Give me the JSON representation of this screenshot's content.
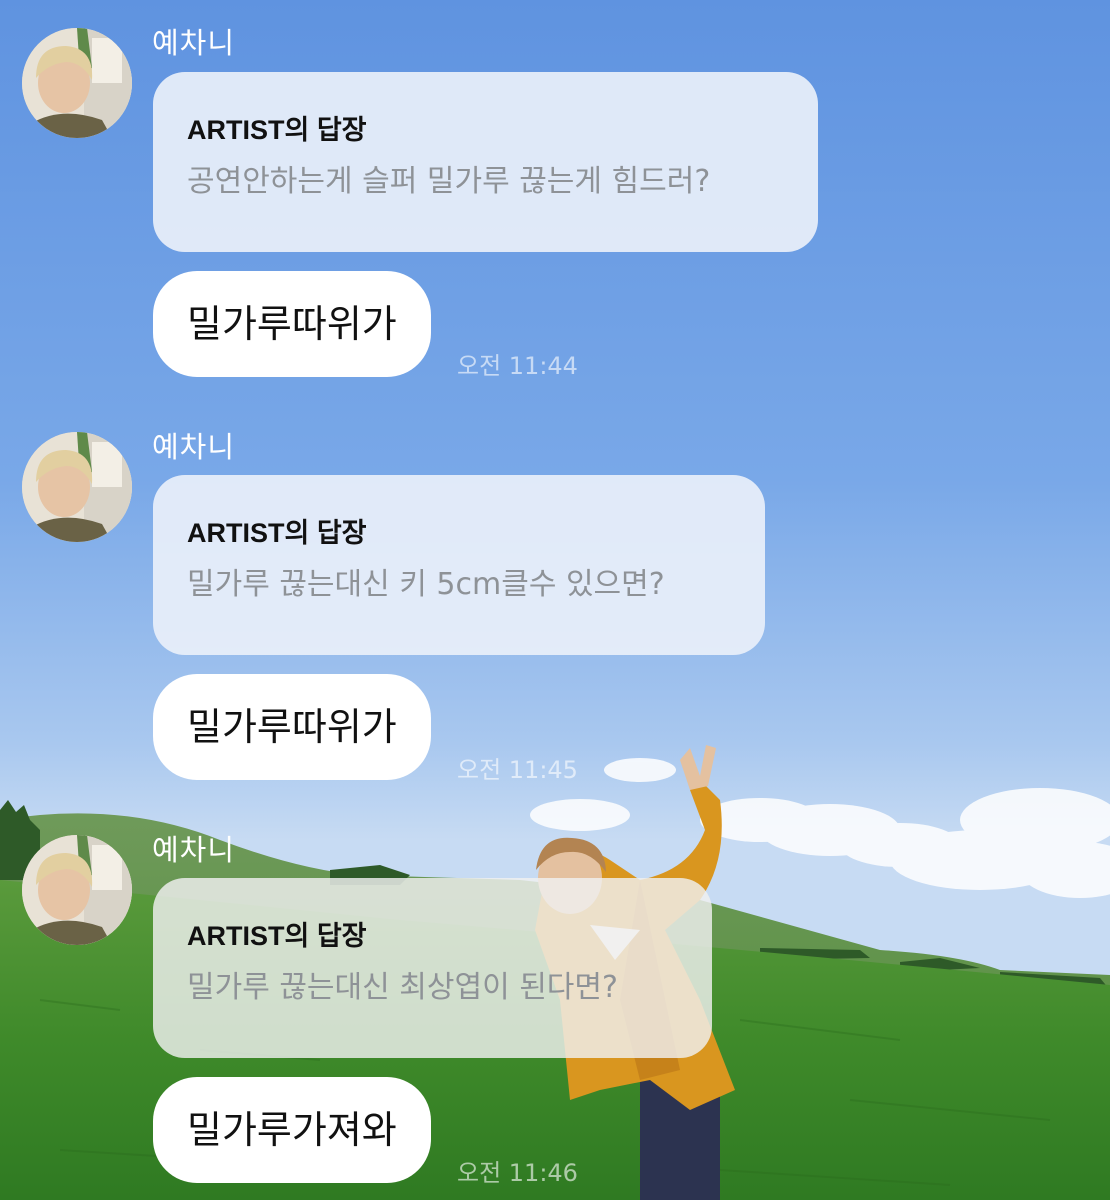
{
  "chat": {
    "messages": [
      {
        "sender": "예차니",
        "reply_title": "ARTIST의 답장",
        "question": "공연안하는게 슬퍼 밀가루 끊는게 힘드러?",
        "answer": "밀가루따위가",
        "time": "오전 11:44"
      },
      {
        "sender": "예차니",
        "reply_title": "ARTIST의 답장",
        "question": "밀가루 끊는대신 키 5cm클수 있으면?",
        "answer": "밀가루따위가",
        "time": "오전 11:45"
      },
      {
        "sender": "예차니",
        "reply_title": "ARTIST의 답장",
        "question": "밀가루 끊는대신 최상엽이 된다면?",
        "answer": "밀가루가져와",
        "time": "오전 11:46"
      }
    ]
  },
  "colors": {
    "sky": "#6f9fe4",
    "grass": "#3f8a2a",
    "bubble": "#ffffff",
    "reply_bubble": "#e8effa",
    "question_text": "#8e9297"
  }
}
